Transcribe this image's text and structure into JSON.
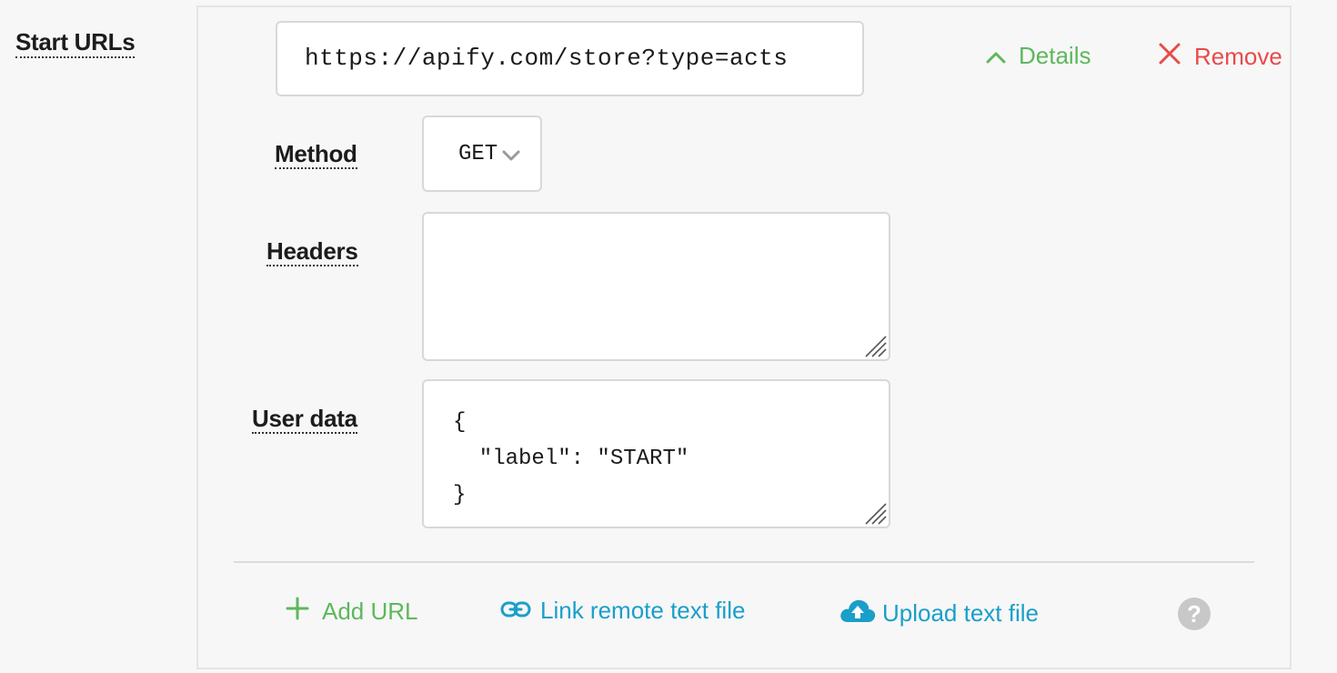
{
  "start_urls": {
    "label": "Start URLs",
    "url_value": "https://apify.com/store?type=acts",
    "details_label": "Details",
    "remove_label": "Remove"
  },
  "request": {
    "method_label": "Method",
    "method_value": "GET",
    "headers_label": "Headers",
    "headers_value": "",
    "user_data_label": "User data",
    "user_data_value": "{\n  \"label\": \"START\"\n}"
  },
  "actions": {
    "add_url": "Add URL",
    "link_remote": "Link remote text file",
    "upload": "Upload text file",
    "help": "?"
  },
  "icons": {
    "details": "chevron-up-icon",
    "remove": "close-icon",
    "method_dropdown": "chevron-down-icon",
    "add_url": "plus-icon",
    "link_remote": "link-icon",
    "upload": "cloud-upload-icon",
    "help": "question-mark-icon"
  },
  "colors": {
    "green": "#5cb85c",
    "red": "#e84b4b",
    "blue": "#1a9fc9",
    "help_gray": "#c8c8c8"
  }
}
